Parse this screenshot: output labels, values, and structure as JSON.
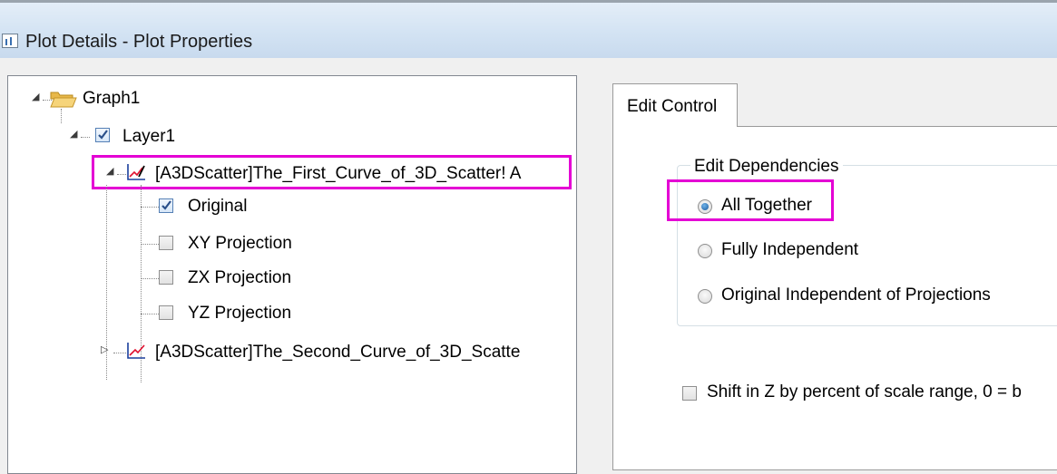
{
  "window": {
    "title": "Plot Details - Plot Properties"
  },
  "tree": {
    "graph": "Graph1",
    "layer": "Layer1",
    "plot1": "[A3DScatter]The_First_Curve_of_3D_Scatter! A",
    "children": [
      "Original",
      "XY Projection",
      "ZX Projection",
      "YZ Projection"
    ],
    "plot2": "[A3DScatter]The_Second_Curve_of_3D_Scatte"
  },
  "tabs": {
    "active": "Edit Control"
  },
  "edit_dependencies": {
    "title": "Edit Dependencies",
    "options": [
      "All Together",
      "Fully Independent",
      "Original Independent of Projections"
    ],
    "selected": "All Together"
  },
  "shift_z": {
    "label": "Shift in Z by percent of scale range, 0 = b",
    "checked": false
  }
}
